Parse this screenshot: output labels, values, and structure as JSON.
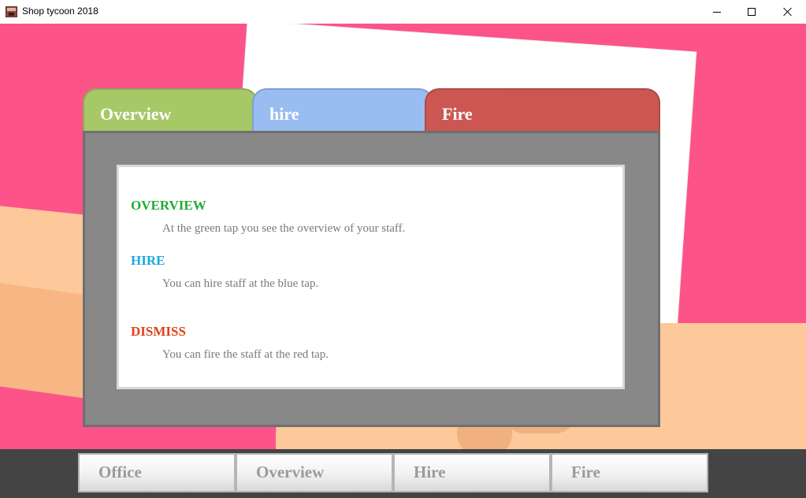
{
  "window": {
    "title": "Shop tycoon 2018"
  },
  "colors": {
    "background": "#fc5489",
    "tab_overview": "#a6c867",
    "tab_hire": "#99bdf1",
    "tab_fire": "#cc5752",
    "overview_title": "#22aa33",
    "hire_title": "#1ba8dc",
    "dismiss_title": "#e0401a"
  },
  "tabs": [
    {
      "label": "Overview"
    },
    {
      "label": "hire"
    },
    {
      "label": "Fire"
    }
  ],
  "help": {
    "overview": {
      "title": "OVERVIEW",
      "text": "At the green tap you see the overview of your staff."
    },
    "hire": {
      "title": "HIRE",
      "text": "You can hire staff at the blue tap."
    },
    "dismiss": {
      "title": "DISMISS",
      "text": "You can fire the staff at the red tap."
    }
  },
  "bottom_nav": [
    {
      "label": "Office"
    },
    {
      "label": "Overview"
    },
    {
      "label": "Hire"
    },
    {
      "label": "Fire"
    }
  ]
}
